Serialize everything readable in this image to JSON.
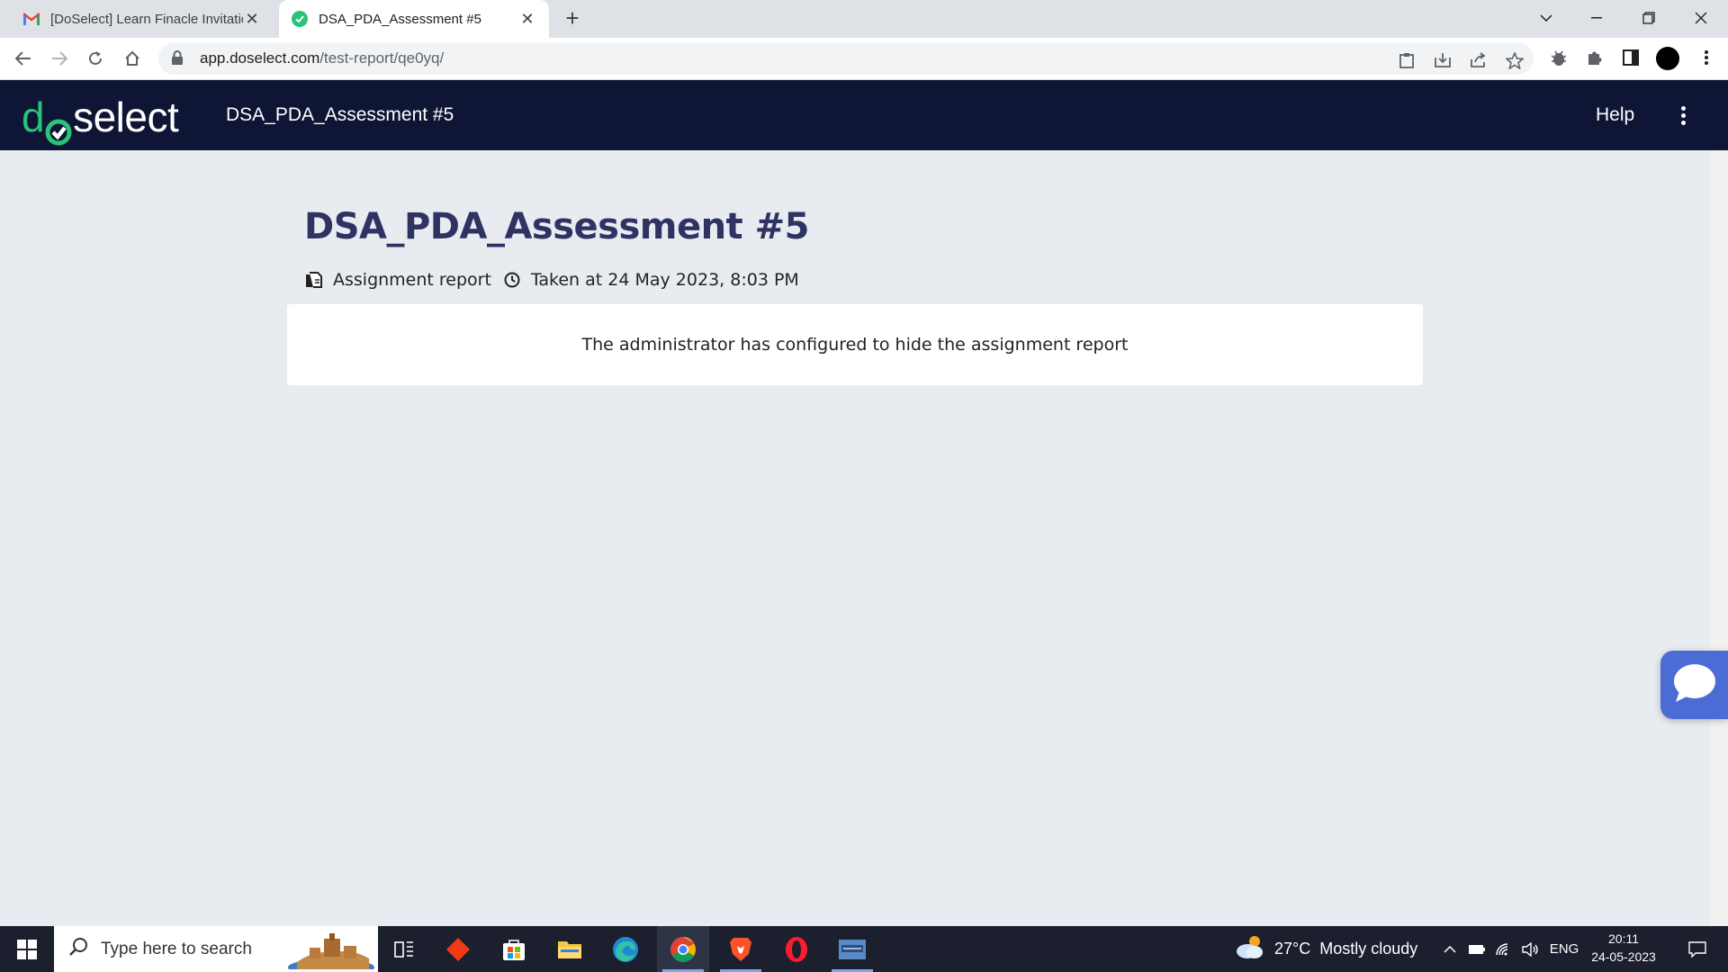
{
  "browser": {
    "tabs": [
      {
        "title": "[DoSelect] Learn Finacle Invitatio",
        "icon": "gmail-icon",
        "active": false
      },
      {
        "title": "DSA_PDA_Assessment #5",
        "icon": "green-check-icon",
        "active": true
      }
    ],
    "url_host": "app.doselect.com",
    "url_path": "/test-report/qe0yq/"
  },
  "site": {
    "logo_prefix": "d",
    "logo_suffix": "select",
    "header_title": "DSA_PDA_Assessment #5",
    "help_label": "Help"
  },
  "report": {
    "title": "DSA_PDA_Assessment #5",
    "type_label": "Assignment report",
    "taken_at": "Taken at 24 May 2023, 8:03 PM",
    "message": "The administrator has configured to hide the assignment report"
  },
  "taskbar": {
    "search_placeholder": "Type here to search",
    "weather_temp": "27°C",
    "weather_desc": "Mostly cloudy",
    "language": "ENG",
    "time": "20:11",
    "date": "24-05-2023"
  },
  "colors": {
    "header_bg": "#0f1535",
    "brand_green": "#2bc27a",
    "title_color": "#2f3362",
    "page_bg": "#e8ecf1",
    "chat_widget": "#4a6cd4"
  }
}
